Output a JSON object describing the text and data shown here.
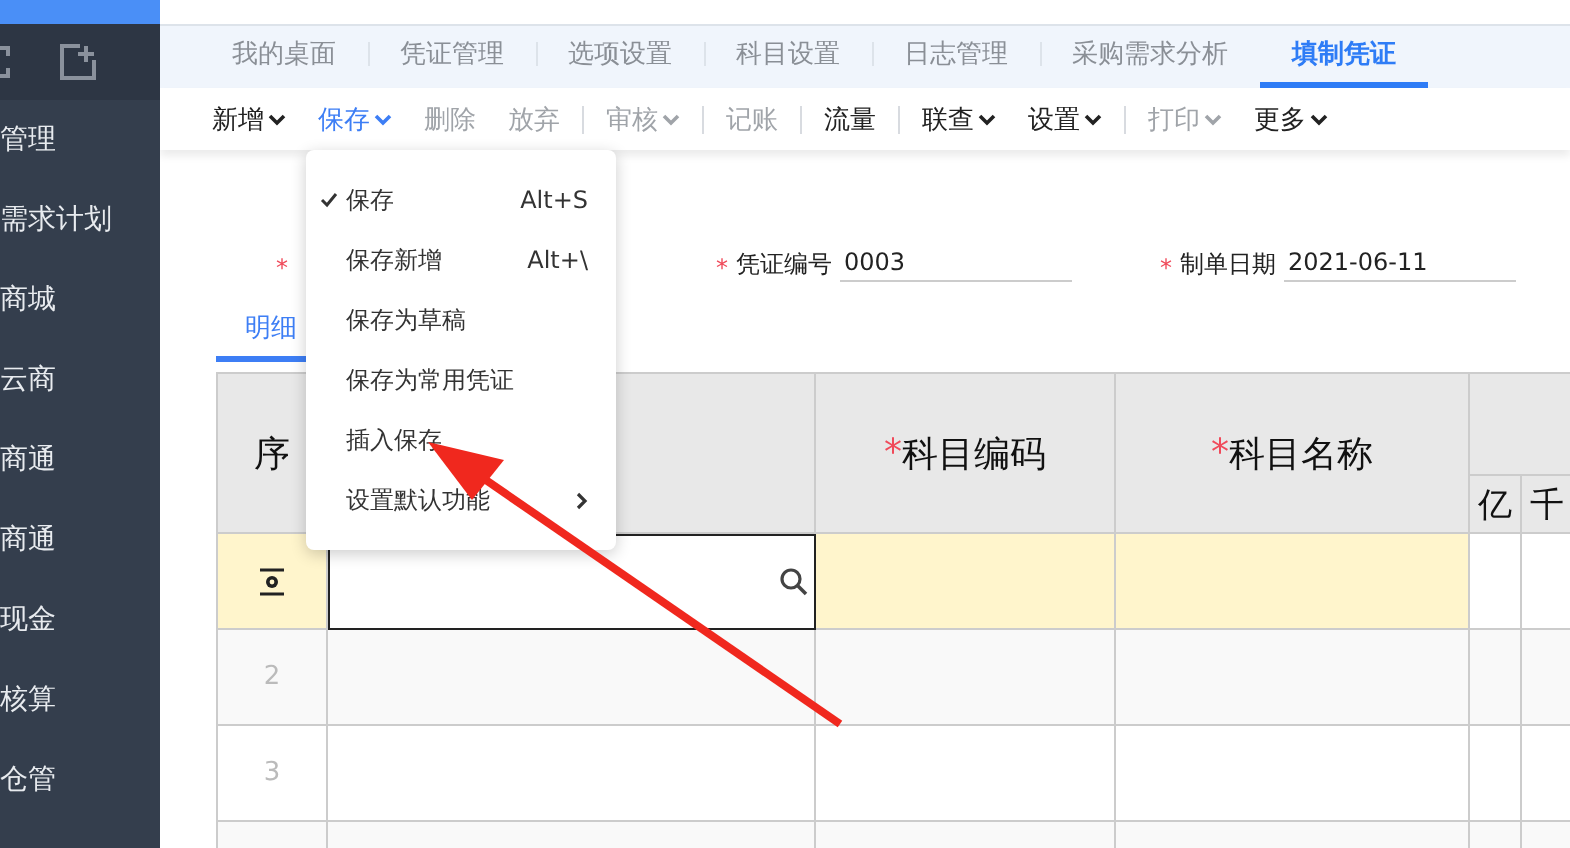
{
  "sidebar": {
    "items": [
      {
        "label": "管理"
      },
      {
        "label": "需求计划"
      },
      {
        "label": "商城"
      },
      {
        "label": "云商"
      },
      {
        "label": "商通"
      },
      {
        "label": "商通"
      },
      {
        "label": "现金"
      },
      {
        "label": "核算"
      },
      {
        "label": "仓管"
      }
    ]
  },
  "tabs": [
    {
      "label": "我的桌面",
      "selected": false
    },
    {
      "label": "凭证管理",
      "selected": false
    },
    {
      "label": "选项设置",
      "selected": false
    },
    {
      "label": "科目设置",
      "selected": false
    },
    {
      "label": "日志管理",
      "selected": false
    },
    {
      "label": "采购需求分析",
      "selected": false
    },
    {
      "label": "填制凭证",
      "selected": true
    }
  ],
  "toolbar": [
    {
      "kind": "button",
      "label": "新增",
      "dropdown": true,
      "disabled": false,
      "active": false
    },
    {
      "kind": "button",
      "label": "保存",
      "dropdown": true,
      "disabled": false,
      "active": true
    },
    {
      "kind": "button",
      "label": "删除",
      "dropdown": false,
      "disabled": true,
      "active": false
    },
    {
      "kind": "button",
      "label": "放弃",
      "dropdown": false,
      "disabled": true,
      "active": false
    },
    {
      "kind": "separator"
    },
    {
      "kind": "button",
      "label": "审核",
      "dropdown": true,
      "disabled": true,
      "active": false
    },
    {
      "kind": "separator"
    },
    {
      "kind": "button",
      "label": "记账",
      "dropdown": false,
      "disabled": true,
      "active": false
    },
    {
      "kind": "separator"
    },
    {
      "kind": "button",
      "label": "流量",
      "dropdown": false,
      "disabled": false,
      "active": false
    },
    {
      "kind": "separator"
    },
    {
      "kind": "button",
      "label": "联查",
      "dropdown": true,
      "disabled": false,
      "active": false
    },
    {
      "kind": "button",
      "label": "设置",
      "dropdown": true,
      "disabled": false,
      "active": false
    },
    {
      "kind": "separator"
    },
    {
      "kind": "button",
      "label": "打印",
      "dropdown": true,
      "disabled": true,
      "active": false
    },
    {
      "kind": "button",
      "label": "更多",
      "dropdown": true,
      "disabled": false,
      "active": false
    }
  ],
  "save_menu": {
    "items": [
      {
        "label": "保存",
        "shortcut": "Alt+S",
        "checked": true,
        "submenu": false
      },
      {
        "label": "保存新增",
        "shortcut": "Alt+\\",
        "checked": false,
        "submenu": false
      },
      {
        "label": "保存为草稿",
        "checked": false,
        "submenu": false
      },
      {
        "label": "保存为常用凭证",
        "checked": false,
        "submenu": false
      },
      {
        "label": "插入保存",
        "checked": false,
        "submenu": false
      },
      {
        "label": "设置默认功能",
        "checked": false,
        "submenu": true
      }
    ]
  },
  "form": {
    "fields": [
      {
        "mark": "*"
      },
      {
        "mark": "*",
        "label": "凭证编号",
        "value": "0003"
      },
      {
        "mark": "*",
        "label": "制单日期",
        "value": "2021-06-11"
      }
    ]
  },
  "detail_tabs": [
    {
      "label": "明细",
      "selected": true
    }
  ],
  "table": {
    "columns": [
      {
        "label": "序"
      },
      {},
      {
        "mark": "*",
        "label": "科目编码"
      },
      {
        "mark": "*",
        "label": "科目名称"
      }
    ],
    "amount_columns": [
      "亿",
      "千"
    ],
    "rows": [
      {
        "selected": true
      },
      {
        "number": "2",
        "selected": false
      },
      {
        "number": "3",
        "selected": false
      },
      {
        "selected": false
      }
    ]
  }
}
